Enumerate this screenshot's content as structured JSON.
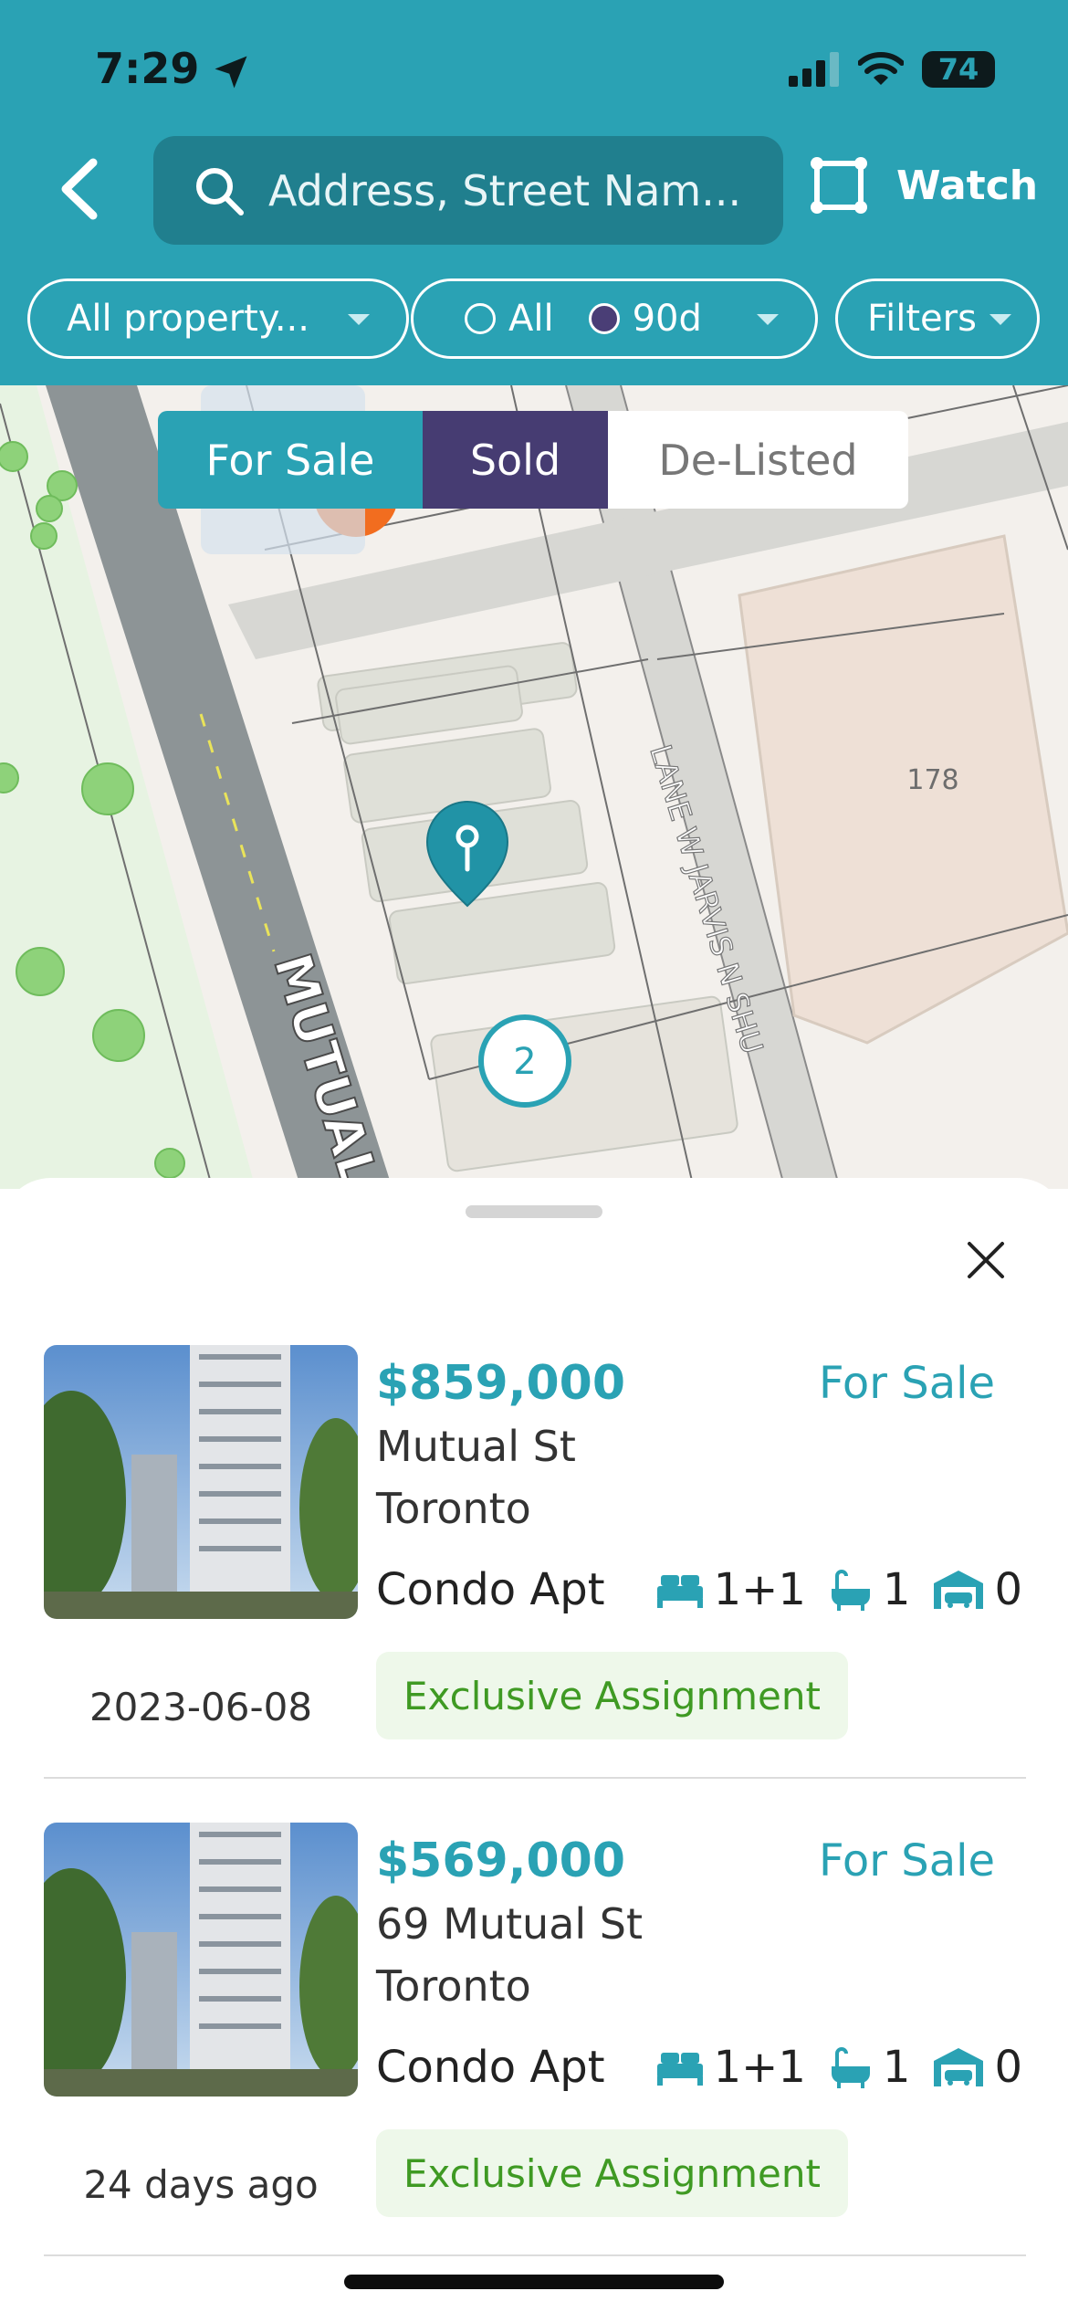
{
  "status_bar": {
    "time": "7:29",
    "battery": "74"
  },
  "header": {
    "search_placeholder": "Address, Street Nam...",
    "watch_label": "Watch",
    "property_filter": "All property...",
    "time_filter_all": "All",
    "time_filter_90d": "90d",
    "filters_label": "Filters"
  },
  "map": {
    "tabs": [
      "For Sale",
      "Sold",
      "De-Listed"
    ],
    "street_label": "MUTUAL",
    "lane_label": "LANE W JARVIS N SHU",
    "building_number": "178",
    "cluster_count": "2"
  },
  "listings": [
    {
      "price": "$859,000",
      "status": "For Sale",
      "address_line1": " Mutual St",
      "address_line2": "Toronto",
      "type": "Condo Apt",
      "beds": "1+1",
      "baths": "1",
      "parking": "0",
      "date": "2023-06-08",
      "badge": "Exclusive Assignment"
    },
    {
      "price": "$569,000",
      "status": "For Sale",
      "address_line1": "69 Mutual St",
      "address_line2": "Toronto",
      "type": "Condo Apt",
      "beds": "1+1",
      "baths": "1",
      "parking": "0",
      "date": "24 days ago",
      "badge": "Exclusive Assignment"
    }
  ],
  "colors": {
    "accent": "#2aa2b4",
    "sold": "#4a3e76",
    "badge_text": "#3f9a23"
  }
}
